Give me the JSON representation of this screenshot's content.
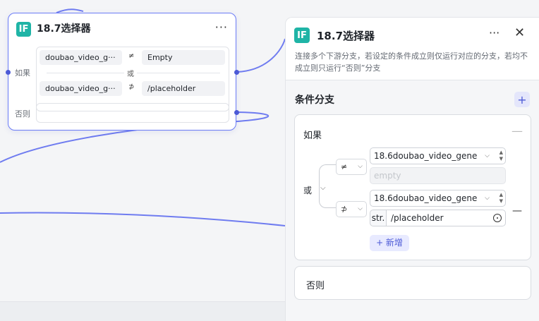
{
  "node": {
    "title": "18.7选择器",
    "badge": "IF",
    "more": "···",
    "if_label": "如果",
    "else_label": "否则",
    "or_label": "或",
    "conditions": [
      {
        "left": "doubao_video_g···",
        "op": "≠",
        "right": "Empty"
      },
      {
        "left": "doubao_video_g···",
        "op": "⊅",
        "right": "/placeholder"
      }
    ]
  },
  "panel": {
    "badge": "IF",
    "title": "18.7选择器",
    "more": "···",
    "close": "✕",
    "description": "连接多个下游分支，若设定的条件成立则仅运行对应的分支，若均不成立则只运行“否则”分支",
    "section_title": "条件分支",
    "add_branch": "+",
    "if_card": {
      "label": "如果",
      "minus": "—",
      "logic": "或",
      "rows": [
        {
          "op": "≠",
          "variable": "18.6doubao_video_gene",
          "value_placeholder": "empty"
        },
        {
          "op": "⊅",
          "variable": "18.6doubao_video_gene",
          "value_type": "str.",
          "value": "/placeholder"
        }
      ],
      "add_label": "+ 新增"
    },
    "else_card": {
      "label": "否则"
    }
  },
  "colors": {
    "accent": "#4c5ad6",
    "badge": "#1fb4a6",
    "edge": "#6f7cf0"
  }
}
